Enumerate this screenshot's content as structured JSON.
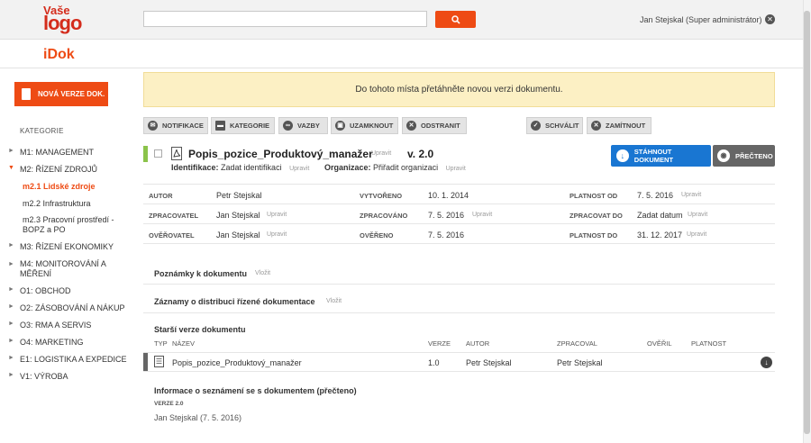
{
  "header": {
    "logo_line1": "Vaše",
    "logo_line2": "logo",
    "search_placeholder": "",
    "user": "Jan Stejskal (Super administrátor)"
  },
  "app": {
    "name": "iDok"
  },
  "sidebar": {
    "new_version": "NOVÁ VERZE DOK.",
    "category_title": "KATEGORIE",
    "items": [
      {
        "label": "M1: MANAGEMENT",
        "arrow": "►"
      },
      {
        "label": "M2: ŘÍZENÍ ZDROJŮ",
        "arrow": "▼"
      },
      {
        "label": "m2.1 Lidské zdroje",
        "arrow": ""
      },
      {
        "label": "m2.2 Infrastruktura",
        "arrow": ""
      },
      {
        "label": "m2.3 Pracovní prostředí - BOPZ a PO",
        "arrow": ""
      },
      {
        "label": "M3: ŘÍZENÍ EKONOMIKY",
        "arrow": "►"
      },
      {
        "label": "M4: MONITOROVÁNÍ A MĚŘENÍ",
        "arrow": "►"
      },
      {
        "label": "O1: OBCHOD",
        "arrow": "►"
      },
      {
        "label": "O2: ZÁSOBOVÁNÍ A NÁKUP",
        "arrow": "►"
      },
      {
        "label": "O3: RMA A SERVIS",
        "arrow": "►"
      },
      {
        "label": "O4: MARKETING",
        "arrow": "►"
      },
      {
        "label": "E1: LOGISTIKA A EXPEDICE",
        "arrow": "►"
      },
      {
        "label": "V1: VÝROBA",
        "arrow": "►"
      }
    ]
  },
  "dropzone": "Do tohoto místa přetáhněte novou verzi dokumentu.",
  "toolbar": {
    "notifikace": "NOTIFIKACE",
    "kategorie": "KATEGORIE",
    "vazby": "VAZBY",
    "uzamknout": "UZAMKNOUT",
    "odstranit": "ODSTRANIT",
    "schvalit": "SCHVÁLIT",
    "zamitnout": "ZAMÍTNOUT"
  },
  "document": {
    "title": "Popis_pozice_Produktový_manažer",
    "edit": "Upravit",
    "version": "v. 2.0",
    "identifier_label": "Identifikace:",
    "identifier_value": "Zadat identifikaci",
    "organization_label": "Organizace:",
    "organization_value": "Přiřadit organizaci",
    "download": "STÁHNOUT DOKUMENT",
    "read": "PŘEČTENO"
  },
  "info": {
    "autor_l": "AUTOR",
    "autor_v": "Petr Stejskal",
    "vytvoreno_l": "VYTVOŘENO",
    "vytvoreno_v": "10. 1. 2014",
    "platnost_od_l": "PLATNOST OD",
    "platnost_od_v": "7. 5. 2016",
    "zpracovatel_l": "ZPRACOVATEL",
    "zpracovatel_v": "Jan Stejskal",
    "zpracovano_l": "ZPRACOVÁNO",
    "zpracovano_v": "7. 5. 2016",
    "zpracovat_do_l": "ZPRACOVAT DO",
    "zpracovat_do_v": "Zadat datum",
    "overovatel_l": "OVĚŘOVATEL",
    "overovatel_v": "Jan Stejskal",
    "overeno_l": "OVĚŘENO",
    "overeno_v": "7. 5. 2016",
    "platnost_do_l": "PLATNOST DO",
    "platnost_do_v": "31. 12. 2017",
    "edit": "Upravit"
  },
  "sections": {
    "notes": "Poznámky k dokumentu",
    "notes_action": "Vložit",
    "distribution": "Záznamy o distribuci řízené dokumentace",
    "distribution_action": "Vložit",
    "older": "Starší verze dokumentu",
    "acquaint": "Informace o seznámení se s dokumentem (přečteno)",
    "acquaint_version": "VERZE 2.0",
    "acquaint_entry": "Jan Stejskal (7. 5. 2016)"
  },
  "history": {
    "headers": {
      "typ": "TYP",
      "nazev": "NÁZEV",
      "verze": "VERZE",
      "autor": "AUTOR",
      "zpracoval": "ZPRACOVAL",
      "overil": "OVĚŘIL",
      "platnost": "PLATNOST"
    },
    "row": {
      "nazev": "Popis_pozice_Produktový_manažer",
      "verze": "1.0",
      "autor": "Petr Stejskal",
      "zpracoval": "Petr Stejskal",
      "overil": "",
      "platnost": ""
    }
  },
  "colors": {
    "accent": "#ee4b14",
    "primary": "#1976d2",
    "warning_bg": "#fcf0c4",
    "approved": "#8bc34a"
  }
}
